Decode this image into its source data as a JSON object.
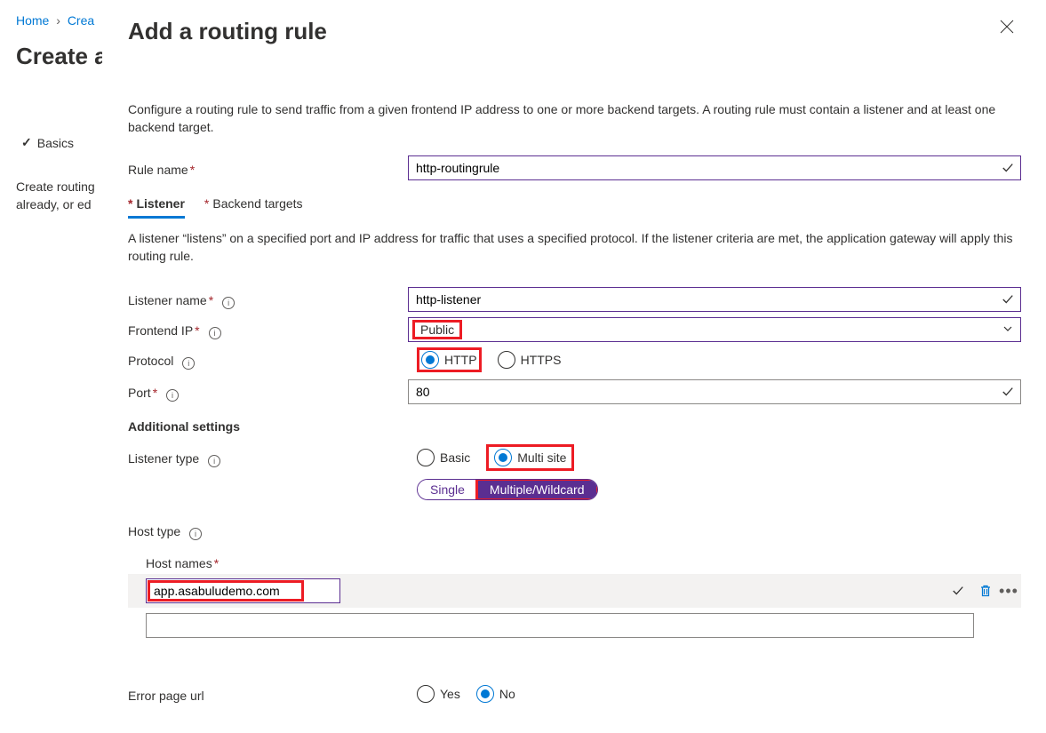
{
  "breadcrumb": {
    "home": "Home",
    "item2": "Crea"
  },
  "bg": {
    "title": "Create a",
    "stepBasics": "Basics",
    "descLine": "Create routing already, or ed"
  },
  "panel": {
    "title": "Add a routing rule",
    "description": "Configure a routing rule to send traffic from a given frontend IP address to one or more backend targets. A routing rule must contain a listener and at least one backend target.",
    "ruleNameLabel": "Rule name",
    "ruleNameValue": "http-routingrule",
    "tabs": {
      "listener": "Listener",
      "backend": "Backend targets"
    },
    "listenerDesc": "A listener “listens” on a specified port and IP address for traffic that uses a specified protocol. If the listener criteria are met, the application gateway will apply this routing rule.",
    "listenerNameLabel": "Listener name",
    "listenerNameValue": "http-listener",
    "frontendIpLabel": "Frontend IP",
    "frontendIpValue": "Public",
    "protocolLabel": "Protocol",
    "protocolHttp": "HTTP",
    "protocolHttps": "HTTPS",
    "portLabel": "Port",
    "portValue": "80",
    "additional": "Additional settings",
    "listenerTypeLabel": "Listener type",
    "listenerTypeBasic": "Basic",
    "listenerTypeMulti": "Multi site",
    "hostTypeLabel": "Host type",
    "hostTypeSingle": "Single",
    "hostTypeMultiple": "Multiple/Wildcard",
    "hostNamesLabel": "Host names",
    "hostNameValue": "app.asabuludemo.com",
    "errorPageLabel": "Error page url",
    "yes": "Yes",
    "no": "No"
  }
}
